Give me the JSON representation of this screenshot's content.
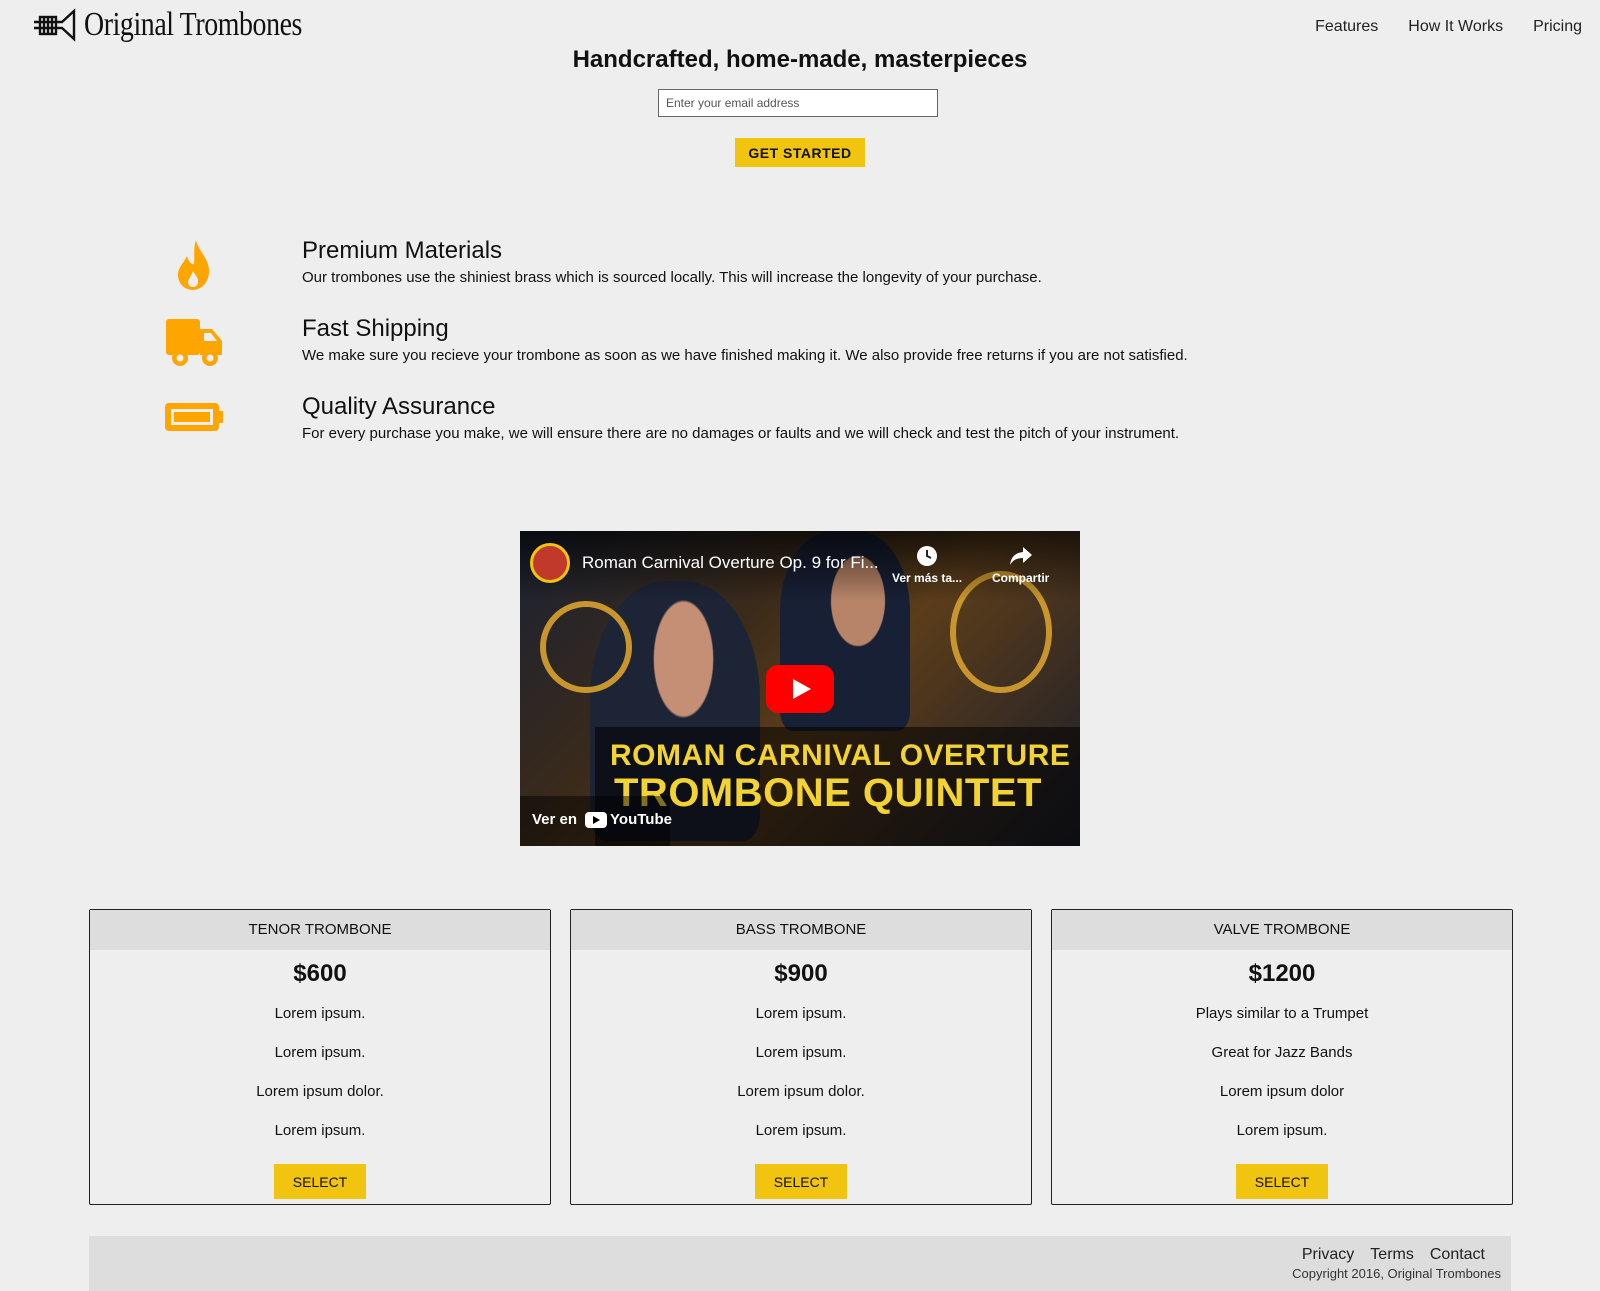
{
  "header": {
    "brand": "Original Trombones",
    "nav": [
      {
        "label": "Features"
      },
      {
        "label": "How It Works"
      },
      {
        "label": "Pricing"
      }
    ]
  },
  "hero": {
    "title": "Handcrafted, home-made, masterpieces",
    "email_placeholder": "Enter your email address",
    "cta_label": "GET STARTED"
  },
  "features": [
    {
      "icon": "fire-icon",
      "title": "Premium Materials",
      "description": "Our trombones use the shiniest brass which is sourced locally. This will increase the longevity of your purchase."
    },
    {
      "icon": "truck-icon",
      "title": "Fast Shipping",
      "description": "We make sure you recieve your trombone as soon as we have finished making it. We also provide free returns if you are not satisfied."
    },
    {
      "icon": "battery-icon",
      "title": "Quality Assurance",
      "description": "For every purchase you make, we will ensure there are no damages or faults and we will check and test the pitch of your instrument."
    }
  ],
  "video": {
    "title": "Roman Carnival Overture Op. 9 for Fi...",
    "watch_later": "Ver más ta...",
    "share": "Compartir",
    "overlay_line1": "ROMAN CARNIVAL OVERTURE",
    "overlay_line2": "TROMBONE QUINTET",
    "watch_on": "Ver en",
    "youtube": "YouTube"
  },
  "pricing": [
    {
      "name": "TENOR TROMBONE",
      "price": "$600",
      "features": [
        "Lorem ipsum.",
        "Lorem ipsum.",
        "Lorem ipsum dolor.",
        "Lorem ipsum."
      ],
      "button": "SELECT"
    },
    {
      "name": "BASS TROMBONE",
      "price": "$900",
      "features": [
        "Lorem ipsum.",
        "Lorem ipsum.",
        "Lorem ipsum dolor.",
        "Lorem ipsum."
      ],
      "button": "SELECT"
    },
    {
      "name": "VALVE TROMBONE",
      "price": "$1200",
      "features": [
        "Plays similar to a Trumpet",
        "Great for Jazz Bands",
        "Lorem ipsum dolor",
        "Lorem ipsum."
      ],
      "button": "SELECT"
    }
  ],
  "footer": {
    "links": [
      {
        "label": "Privacy"
      },
      {
        "label": "Terms"
      },
      {
        "label": "Contact"
      }
    ],
    "copyright": "Copyright 2016, Original Trombones"
  },
  "colors": {
    "accent": "#f1c40f",
    "icon_orange": "#ffa500",
    "background": "#eeeeee",
    "panel": "#dddddd"
  }
}
